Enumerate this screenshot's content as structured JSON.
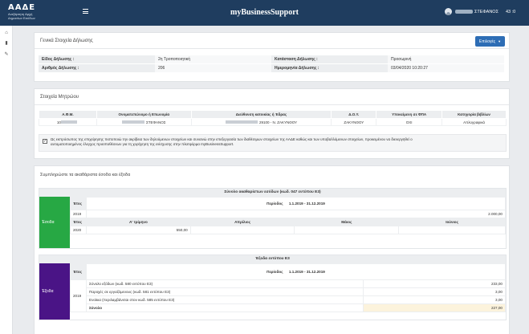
{
  "header": {
    "brand": "ΑΑΔΕ",
    "brand_sub1": "Ανεξάρτητη Αρχή",
    "brand_sub2": "Δημοσίων Εσόδων",
    "app_title": "myBusinessSupport",
    "user_name": "ΣΤΕΦΑΝΟΣ",
    "timer": "43 :0"
  },
  "sidebar": {
    "icons": [
      "home-icon",
      "book-icon",
      "edit-icon"
    ]
  },
  "general": {
    "title": "Γενικά Στοιχεία Δήλωσης",
    "options_button": "Επιλογές",
    "rows": [
      {
        "l1": "Είδος Δήλωσης :",
        "v1": "2η Τροποποιητική",
        "l2": "Κατάσταση Δήλωσης :",
        "v2": "Προσωρινή"
      },
      {
        "l1": "Αριθμός Δήλωσης :",
        "v1": "206",
        "l2": "Ημερομηνία Δήλωσης :",
        "v2": "03/04/2020 10:20:27"
      }
    ]
  },
  "registry": {
    "title": "Στοιχεία Μητρώου",
    "headers": [
      "Α.Φ.Μ.",
      "Ονοματεπώνυμο ή Επωνυμία",
      "Διεύθυνση κατοικίας ή Έδρας",
      "Δ.Ο.Υ.",
      "Υποκείμενη σε ΦΠΑ",
      "Κατηγορία βιβλίων"
    ],
    "row": {
      "afm": "10",
      "name": "ΣΤΕΦΑΝΟΣ",
      "address": "29100 - Ν. ΖΑΚΥΝΘΟΥ",
      "doy": "ΖΑΚΥΝΘΟΥ",
      "vat": "ΟΧΙ",
      "books": "Απλογραφικά"
    },
    "notice_line1": "Ως εκπρόσωπος της επιχείρησης πιστοποιώ την ακρίβεια των δηλούμενων στοιχείων και συναινώ στην επεξεργασία των διαθέσιμων στοιχείων της ΑΑΔΕ καθώς και των υποβαλλόμενων στοιχείων, προκειμένου να διενεργηθεί ο",
    "notice_line2": "αυτοματοποιημένος έλεγχος προϋποθέσεων για τη χορήγηση της ενίσχυσης στην πλατφόρμα myBusinessSupport."
  },
  "fill": {
    "title": "Συμπληρώστε τα ακαθάριστα έσοδα και έξοδα",
    "income": {
      "header": "Σύνολο ακαθαρίστων εσόδων (κωδ. 047 εντύπου Ε3)",
      "side_label": "Έσοδα",
      "side_color": "#27a844",
      "year_label": "Έτος",
      "period_label": "Περίοδος",
      "period_value": "1.1.2019 - 31.12.2019",
      "year1": "2019",
      "value1": "2.000,00",
      "quarters": [
        "Α' τρίμηνο",
        "Απρίλιος",
        "Μάιος",
        "Ιούνιος"
      ],
      "year2": "2020",
      "q1_value": "550,00"
    },
    "expenses": {
      "header": "Έξοδα εντύπου Ε3",
      "side_label": "Έξοδα",
      "side_color": "#4a1486",
      "year_label": "Έτος",
      "period_label": "Περίοδος",
      "period_value": "1.1.2019 - 31.12.2019",
      "year": "2019",
      "rows": [
        {
          "label": "Σύνολο εξόδων (κωδ. 580 εντύπου Ε3)",
          "value": "233,00"
        },
        {
          "label": "Παροχές σε εργαζόμενους (κωδ. 581 εντύπου Ε3)",
          "value": "3,00"
        },
        {
          "label": "Ενοίκια (περιλαμβάνεται στον κωδ. 585 εντύπου Ε3)",
          "value": "3,00"
        }
      ],
      "total_label": "Σύνολο",
      "total_value": "227,00"
    }
  }
}
